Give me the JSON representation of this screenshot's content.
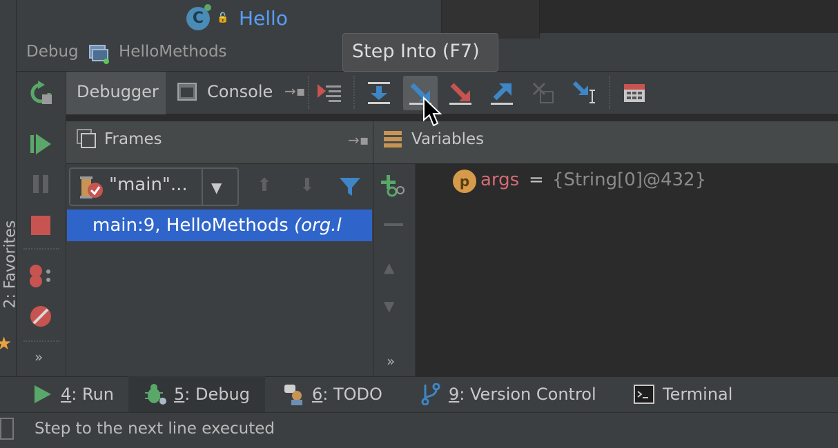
{
  "editor": {
    "tab_title": "Hello"
  },
  "debug_window": {
    "label": "Debug",
    "config_name": "HelloMethods"
  },
  "tooltip": {
    "text": "Step Into (F7)"
  },
  "tabs": {
    "debugger_label": "Debugger",
    "console_label": "Console"
  },
  "toolbar": {
    "buttons": [
      "show-execution-point",
      "step-over",
      "step-into",
      "force-step-into",
      "step-out",
      "drop-frame",
      "run-to-cursor",
      "evaluate-expression"
    ],
    "active": "step-into"
  },
  "frames": {
    "header": "Frames",
    "thread": "\"main\"...",
    "rows": [
      {
        "method": "main:9, HelloMethods ",
        "package": "(org.l"
      }
    ]
  },
  "variables": {
    "header": "Variables",
    "items": [
      {
        "badge": "p",
        "name": "args",
        "eq": "=",
        "value": "{String[0]@432}"
      }
    ]
  },
  "side_nav": {
    "favorites_label": "2: Favorites",
    "more": "»"
  },
  "bottom_tools": [
    {
      "key": "4",
      "label": ": Run"
    },
    {
      "key": "5",
      "label": ": Debug"
    },
    {
      "key": "6",
      "label": ": TODO"
    },
    {
      "key": "9",
      "label": ": Version Control"
    },
    {
      "key": "",
      "label": "Terminal"
    }
  ],
  "status_bar": {
    "message": "Step to the next line executed"
  },
  "colors": {
    "accent_blue": "#589df6",
    "selection": "#2f65ca",
    "panel": "#3c3f41",
    "editor_bg": "#2b2b2b"
  }
}
